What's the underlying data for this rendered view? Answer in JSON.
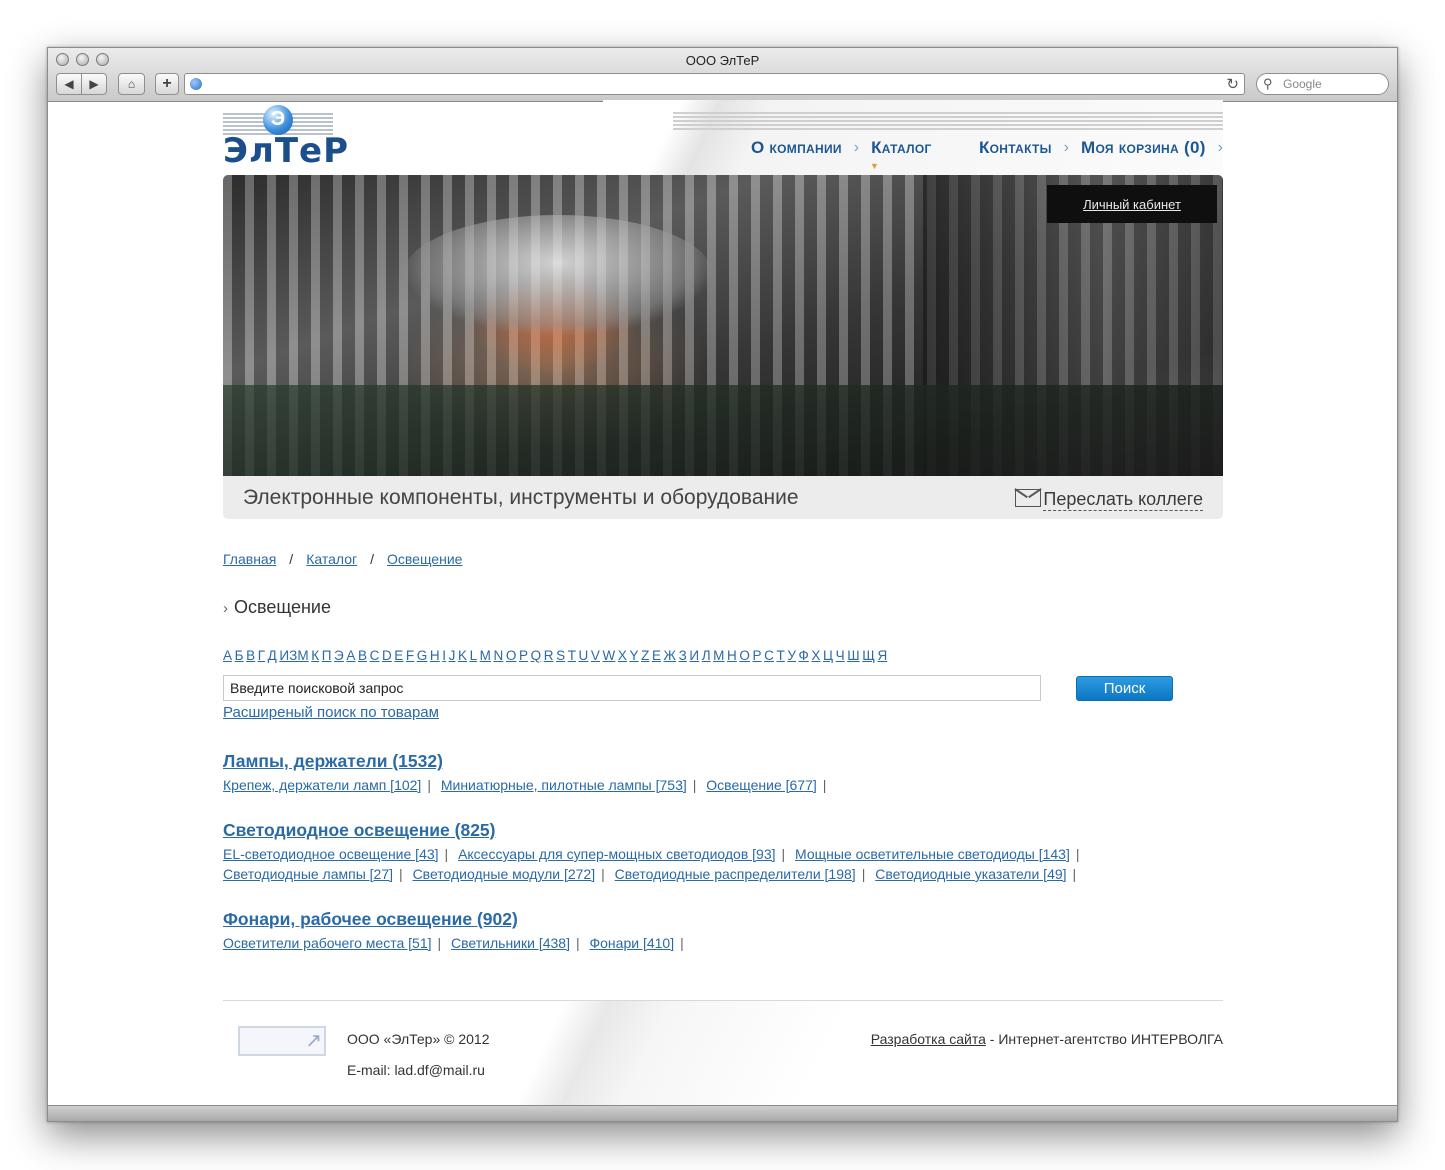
{
  "browser": {
    "window_title": "ООО ЭлТеР",
    "search_placeholder": "Google",
    "add_label": "+"
  },
  "logo": {
    "text": "ЭлТеР",
    "mark": "Э"
  },
  "nav": {
    "about": "О компании",
    "catalog": "Каталог",
    "contacts": "Контакты",
    "cart": "Моя корзина (0)"
  },
  "cabinet": "Личный кабинет",
  "slogan": "Электронные компоненты, инструменты и оборудование",
  "forward": "Переслать коллеге",
  "breadcrumb": {
    "home": "Главная",
    "catalog": "Каталог",
    "current": "Освещение"
  },
  "page_title": "Освещение",
  "alphabet": [
    "А",
    "Б",
    "В",
    "Г",
    "Д",
    "ИЗМ",
    "К",
    "П",
    "Э",
    "А",
    "В",
    "С",
    "D",
    "E",
    "F",
    "G",
    "H",
    "I",
    "J",
    "K",
    "L",
    "M",
    "N",
    "O",
    "P",
    "Q",
    "R",
    "S",
    "T",
    "U",
    "V",
    "W",
    "X",
    "Y",
    "Z",
    "Е",
    "Ж",
    "З",
    "И",
    "Л",
    "М",
    "Н",
    "О",
    "Р",
    "С",
    "Т",
    "У",
    "Ф",
    "Х",
    "Ц",
    "Ч",
    "Ш",
    "Щ",
    "Я"
  ],
  "search": {
    "placeholder": "Введите поисковой запрос",
    "button": "Поиск",
    "advanced": "Расширеный поиск по товарам"
  },
  "categories": [
    {
      "title": "Лампы, держатели (1532)",
      "links": [
        "Крепеж, держатели ламп [102]",
        "Миниатюрные, пилотные лампы [753]",
        "Освещение [677]"
      ]
    },
    {
      "title": "Светодиодное освещение (825)",
      "links": [
        "EL-светодиодное освещение [43]",
        "Аксессуары для супер-мощных светодиодов [93]",
        "Мощные осветительные светодиоды [143]",
        "Светодиодные лампы [27]",
        "Светодиодные модули [272]",
        "Светодиодные распределители [198]",
        "Светодиодные указатели [49]"
      ]
    },
    {
      "title": "Фонари, рабочее освещение (902)",
      "links": [
        "Осветители рабочего места [51]",
        "Светильники [438]",
        "Фонари [410]"
      ]
    }
  ],
  "footer": {
    "copyright": "ООО «ЭлТер» © 2012",
    "email": "E-mail: lad.df@mail.ru",
    "dev_link": "Разработка сайта",
    "dev_text": " - Интернет-агентство ИНТЕРВОЛГА"
  }
}
